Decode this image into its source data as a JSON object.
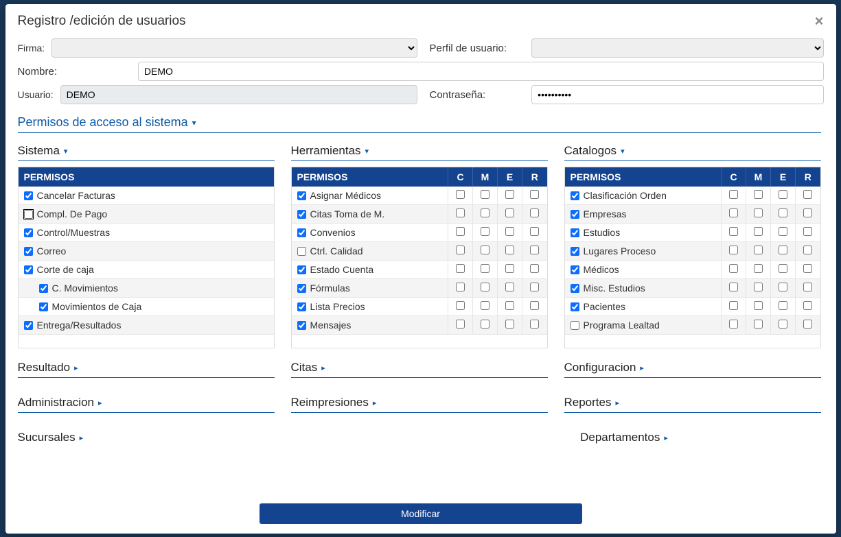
{
  "modal": {
    "title": "Registro /edición de usuarios",
    "close": "×"
  },
  "form": {
    "firma_label": "Firma:",
    "perfil_label": "Perfil de usuario:",
    "nombre_label": "Nombre:",
    "nombre_value": "DEMO",
    "usuario_label": "Usuario:",
    "usuario_value": "DEMO",
    "contrasena_label": "Contraseña:",
    "contrasena_value": "••••••••••"
  },
  "permissions_header": "Permisos de acceso al sistema",
  "columns": {
    "permisos": "PERMISOS",
    "c": "C",
    "m": "M",
    "e": "E",
    "r": "R"
  },
  "groups": {
    "sistema": {
      "title": "Sistema",
      "rows": [
        {
          "label": "Cancelar Facturas",
          "checked": true
        },
        {
          "label": "Compl. De Pago",
          "checked": false,
          "outline": true
        },
        {
          "label": "Control/Muestras",
          "checked": true
        },
        {
          "label": "Correo",
          "checked": true
        },
        {
          "label": "Corte de caja",
          "checked": true
        },
        {
          "label": "C. Movimientos",
          "checked": true,
          "indent": true
        },
        {
          "label": "Movimientos de Caja",
          "checked": true,
          "indent": true
        },
        {
          "label": "Entrega/Resultados",
          "checked": true
        }
      ]
    },
    "herramientas": {
      "title": "Herramientas",
      "rows": [
        {
          "label": "Asignar Médicos",
          "checked": true
        },
        {
          "label": "Citas Toma de M.",
          "checked": true
        },
        {
          "label": "Convenios",
          "checked": true
        },
        {
          "label": "Ctrl. Calidad",
          "checked": false
        },
        {
          "label": "Estado Cuenta",
          "checked": true
        },
        {
          "label": "Fórmulas",
          "checked": true
        },
        {
          "label": "Lista Precios",
          "checked": true
        },
        {
          "label": "Mensajes",
          "checked": true
        }
      ]
    },
    "catalogos": {
      "title": "Catalogos",
      "rows": [
        {
          "label": "Clasificación Orden",
          "checked": true
        },
        {
          "label": "Empresas",
          "checked": true
        },
        {
          "label": "Estudios",
          "checked": true
        },
        {
          "label": "Lugares Proceso",
          "checked": true
        },
        {
          "label": "Médicos",
          "checked": true
        },
        {
          "label": "Misc. Estudios",
          "checked": true
        },
        {
          "label": "Pacientes",
          "checked": true
        },
        {
          "label": "Programa Lealtad",
          "checked": false
        }
      ]
    }
  },
  "collapsed_sections": {
    "resultado": "Resultado",
    "citas": "Citas",
    "configuracion": "Configuracion",
    "administracion": "Administracion",
    "reimpresiones": "Reimpresiones",
    "reportes": "Reportes",
    "sucursales": "Sucursales",
    "departamentos": "Departamentos"
  },
  "footer": {
    "modificar": "Modificar"
  }
}
